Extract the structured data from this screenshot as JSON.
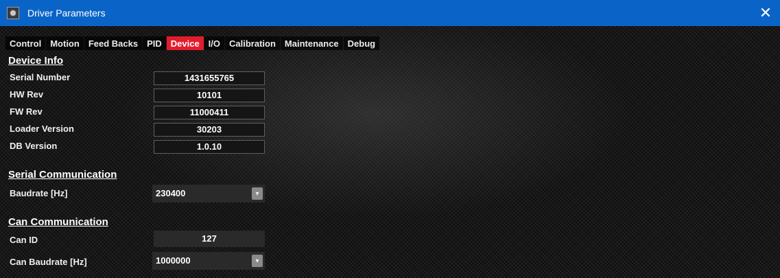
{
  "window": {
    "title": "Driver Parameters",
    "close_glyph": "✕",
    "icon": "app-icon"
  },
  "tabs": [
    {
      "label": "Control"
    },
    {
      "label": "Motion"
    },
    {
      "label": "Feed Backs"
    },
    {
      "label": "PID"
    },
    {
      "label": "Device",
      "active": true
    },
    {
      "label": "I/O"
    },
    {
      "label": "Calibration"
    },
    {
      "label": "Maintenance"
    },
    {
      "label": "Debug"
    }
  ],
  "device_info": {
    "heading": "Device Info",
    "rows": [
      {
        "label": "Serial Number",
        "value": "1431655765"
      },
      {
        "label": "HW Rev",
        "value": "10101"
      },
      {
        "label": "FW Rev",
        "value": "11000411"
      },
      {
        "label": "Loader Version",
        "value": "30203"
      },
      {
        "label": "DB Version",
        "value": "1.0.10"
      }
    ]
  },
  "serial_comm": {
    "heading": "Serial Communication",
    "baudrate_label": "Baudrate [Hz]",
    "baudrate_value": "230400"
  },
  "can_comm": {
    "heading": "Can Communication",
    "can_id_label": "Can ID",
    "can_id_value": "127",
    "can_baudrate_label": "Can Baudrate [Hz]",
    "can_baudrate_value": "1000000"
  },
  "dropdown_glyph": "▾",
  "colors": {
    "titlebar": "#0a64c8",
    "active_tab": "#e21c2b"
  }
}
